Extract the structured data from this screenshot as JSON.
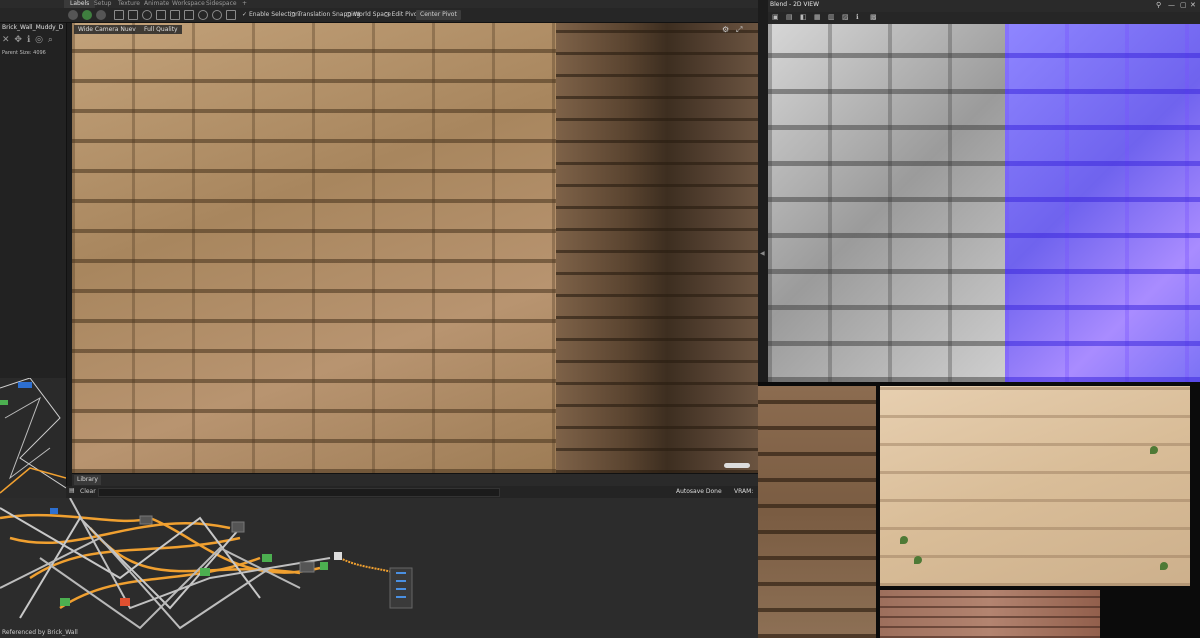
{
  "tabs": [
    "Labels",
    "Setup",
    "Texture",
    "Animate",
    "Workspace",
    "Sidespace"
  ],
  "tab_plus": "+",
  "toolbar": {
    "enable_selection": "Enable Selection",
    "translation_snapping": "Translation Snapping",
    "world_space": "World Space",
    "edit_pivot": "Edit Pivot",
    "center_pivot": "Center Pivot"
  },
  "left_panel": {
    "title": "Brick_Wall_Muddy_D",
    "parent_size_label": "Parent Size:",
    "parent_size_value": "4096"
  },
  "viewport": {
    "camera": "Wide Camera Nuev",
    "quality": "Full Quality"
  },
  "library": {
    "tab": "Library"
  },
  "log": {
    "clear": "Clear",
    "autosave": "Autosave Done",
    "vram": "VRAM: 42"
  },
  "graph": {
    "footer": "Referenced by Brick_Wall"
  },
  "view2d": {
    "title": "Blend - 2D VIEW"
  },
  "colors": {
    "panel_bg": "#222222",
    "node_orange": "#f0a030",
    "node_green": "#4caf50",
    "normal_blue": "#7b72f5"
  }
}
